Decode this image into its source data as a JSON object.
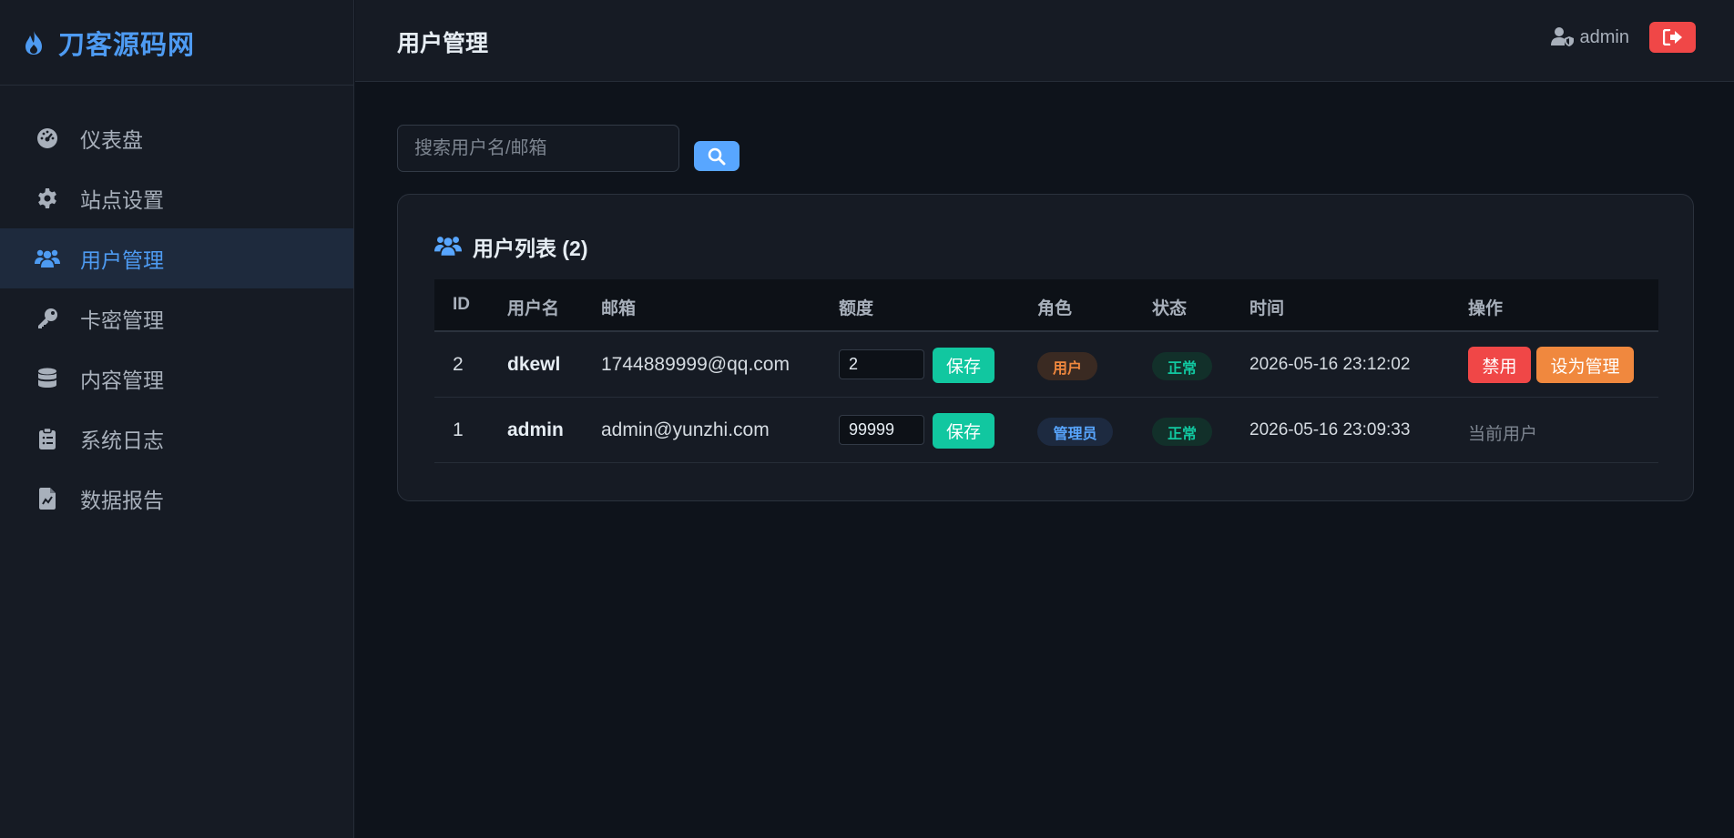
{
  "brand": {
    "name": "刀客源码网"
  },
  "sidebar": {
    "items": [
      {
        "label": "仪表盘",
        "icon": "dashboard-icon"
      },
      {
        "label": "站点设置",
        "icon": "gear-icon"
      },
      {
        "label": "用户管理",
        "icon": "users-icon",
        "active": true
      },
      {
        "label": "卡密管理",
        "icon": "key-icon"
      },
      {
        "label": "内容管理",
        "icon": "database-icon"
      },
      {
        "label": "系统日志",
        "icon": "clipboard-icon"
      },
      {
        "label": "数据报告",
        "icon": "report-icon"
      }
    ]
  },
  "header": {
    "title": "用户管理",
    "username": "admin"
  },
  "search": {
    "placeholder": "搜索用户名/邮箱"
  },
  "card": {
    "title": "用户列表 (2)"
  },
  "table": {
    "columns": [
      "ID",
      "用户名",
      "邮箱",
      "额度",
      "角色",
      "状态",
      "时间",
      "操作"
    ],
    "rows": [
      {
        "id": "2",
        "username": "dkewl",
        "email": "1744889999@qq.com",
        "quota": "2",
        "save": "保存",
        "role": "用户",
        "status": "正常",
        "time": "2026-05-16 23:12:02",
        "ban": "禁用",
        "set_admin": "设为管理"
      },
      {
        "id": "1",
        "username": "admin",
        "email": "admin@yunzhi.com",
        "quota": "99999",
        "save": "保存",
        "role": "管理员",
        "status": "正常",
        "time": "2026-05-16 23:09:33",
        "current": "当前用户"
      }
    ]
  },
  "colors": {
    "accent": "#4e9bf2",
    "success": "#11c7a0",
    "danger": "#f04747",
    "warning": "#f0883e"
  }
}
